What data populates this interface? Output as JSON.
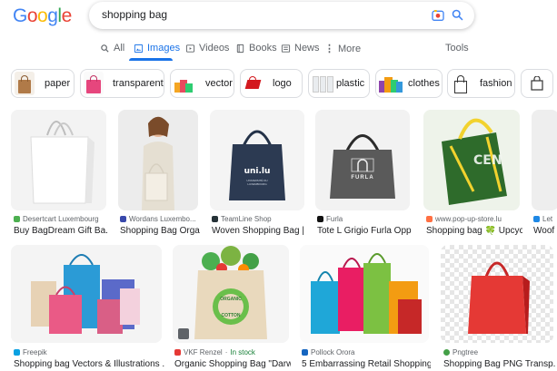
{
  "header": {
    "logo_letters": [
      {
        "ch": "G",
        "color": "#4285F4"
      },
      {
        "ch": "o",
        "color": "#EA4335"
      },
      {
        "ch": "o",
        "color": "#FBBC05"
      },
      {
        "ch": "g",
        "color": "#4285F4"
      },
      {
        "ch": "l",
        "color": "#34A853"
      },
      {
        "ch": "e",
        "color": "#EA4335"
      }
    ],
    "search_value": "shopping bag"
  },
  "tabs": {
    "all": "All",
    "images": "Images",
    "videos": "Videos",
    "books": "Books",
    "news": "News",
    "more": "More",
    "tools": "Tools",
    "active_color": "#1a73e8"
  },
  "chips": [
    "paper",
    "transparent",
    "vector",
    "logo",
    "plastic",
    "clothes",
    "fashion"
  ],
  "results_row1": [
    {
      "source": "Desertcart Luxembourg",
      "title": "Buy BagDream Gift Ba..."
    },
    {
      "source": "Wordans Luxembo...",
      "title": "Shopping Bag Orga..."
    },
    {
      "source": "TeamLine Shop",
      "title": "Woven Shopping Bag | ..."
    },
    {
      "source": "Furla",
      "title": "Tote L Grigio Furla Opp..."
    },
    {
      "source": "www.pop-up-store.lu",
      "title": "Shopping bag 🍀 Upcycli..."
    },
    {
      "source": "Let",
      "title": "Woof"
    }
  ],
  "results_row2": [
    {
      "source": "Freepik",
      "title": "Shopping bag Vectors & Illustrations ..."
    },
    {
      "source": "VKF Renzel",
      "source_extra": "In stock",
      "title": "Organic Shopping Bag \"Darwi..."
    },
    {
      "source": "Pollock Orora",
      "title": "5 Embarrassing Retail Shopping ..."
    },
    {
      "source": "Pngtree",
      "title": "Shopping Bag PNG Transp..."
    }
  ],
  "image_text": {
    "unilu_main": "uni.lu",
    "unilu_sub": "UNIVERSITÉ DU LUXEMBOURG",
    "furla": "FURLA",
    "organic_top": "ORGANIC",
    "organic_bottom": "COTTON"
  }
}
